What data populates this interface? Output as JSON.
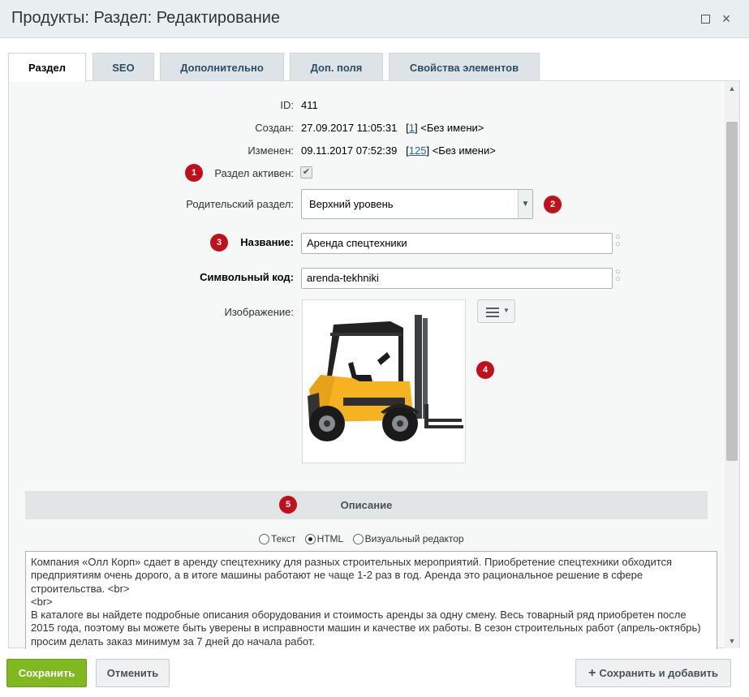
{
  "window": {
    "title": "Продукты: Раздел: Редактирование",
    "maximize_icon": "maximize-icon",
    "close_icon": "close-icon",
    "close_glyph": "×"
  },
  "tabs": [
    {
      "label": "Раздел",
      "active": true
    },
    {
      "label": "SEO",
      "active": false
    },
    {
      "label": "Дополнительно",
      "active": false
    },
    {
      "label": "Доп. поля",
      "active": false
    },
    {
      "label": "Свойства элементов",
      "active": false
    }
  ],
  "form": {
    "id_label": "ID:",
    "id_value": "411",
    "created_label": "Создан:",
    "created_value": "27.09.2017 11:05:31",
    "created_user_id": "1",
    "created_user_name": "<Без имени>",
    "modified_label": "Изменен:",
    "modified_value": "09.11.2017 07:52:39",
    "modified_user_id": "125",
    "modified_user_name": "<Без имени>",
    "active_label": "Раздел активен:",
    "active_checked": true,
    "parent_label": "Родительский раздел:",
    "parent_value": "Верхний уровень",
    "name_label": "Название:",
    "name_value": "Аренда спецтехники",
    "code_label": "Символьный код:",
    "code_value": "arenda-tekhniki",
    "image_label": "Изображение:"
  },
  "badges": [
    "1",
    "2",
    "3",
    "4",
    "5"
  ],
  "description": {
    "section_title": "Описание",
    "modes": [
      {
        "label": "Текст",
        "selected": false
      },
      {
        "label": "HTML",
        "selected": true
      },
      {
        "label": "Визуальный редактор",
        "selected": false
      }
    ],
    "text": "Компания «Олл Корп» сдает в аренду спецтехнику для разных строительных мероприятий. Приобретение спецтехники обходится предприятиям очень дорого, а в итоге машины работают не чаще 1-2 раз в год. Аренда это рациональное решение в сфере строительства. <br>\n<br>\nВ каталоге вы найдете подробные описания оборудования и стоимость аренды за одну смену. Весь товарный ряд приобретен после 2015 года, поэтому вы можете быть уверены в исправности машин и качестве их работы. В сезон строительных работ (апрель-октябрь) просим делать заказ минимум за 7 дней до начала работ."
  },
  "buttons": {
    "save": "Сохранить",
    "cancel": "Отменить",
    "save_add": "Сохранить и добавить"
  },
  "colors": {
    "accent_save": "#7fb81f",
    "badge": "#c0101a",
    "link": "#2067b0"
  }
}
